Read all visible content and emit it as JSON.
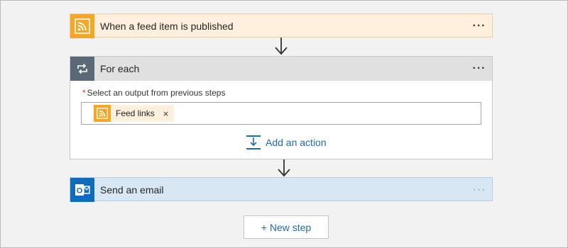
{
  "trigger": {
    "title": "When a feed item is published",
    "icon": "rss-icon",
    "more_label": "···"
  },
  "foreach": {
    "title": "For each",
    "icon": "loop-icon",
    "more_label": "···",
    "required_marker": "*",
    "field_label": "Select an output from previous steps",
    "token": {
      "label": "Feed links",
      "icon": "rss-icon",
      "remove_label": "×"
    },
    "add_action_label": "Add an action"
  },
  "email": {
    "title": "Send an email",
    "icon": "outlook-icon",
    "more_label": "···"
  },
  "new_step_label": "+ New step",
  "colors": {
    "rss_orange": "#f5a623",
    "loop_gray": "#5b6976",
    "outlook_blue": "#0f6cbd",
    "link_blue": "#1e6ab3"
  }
}
